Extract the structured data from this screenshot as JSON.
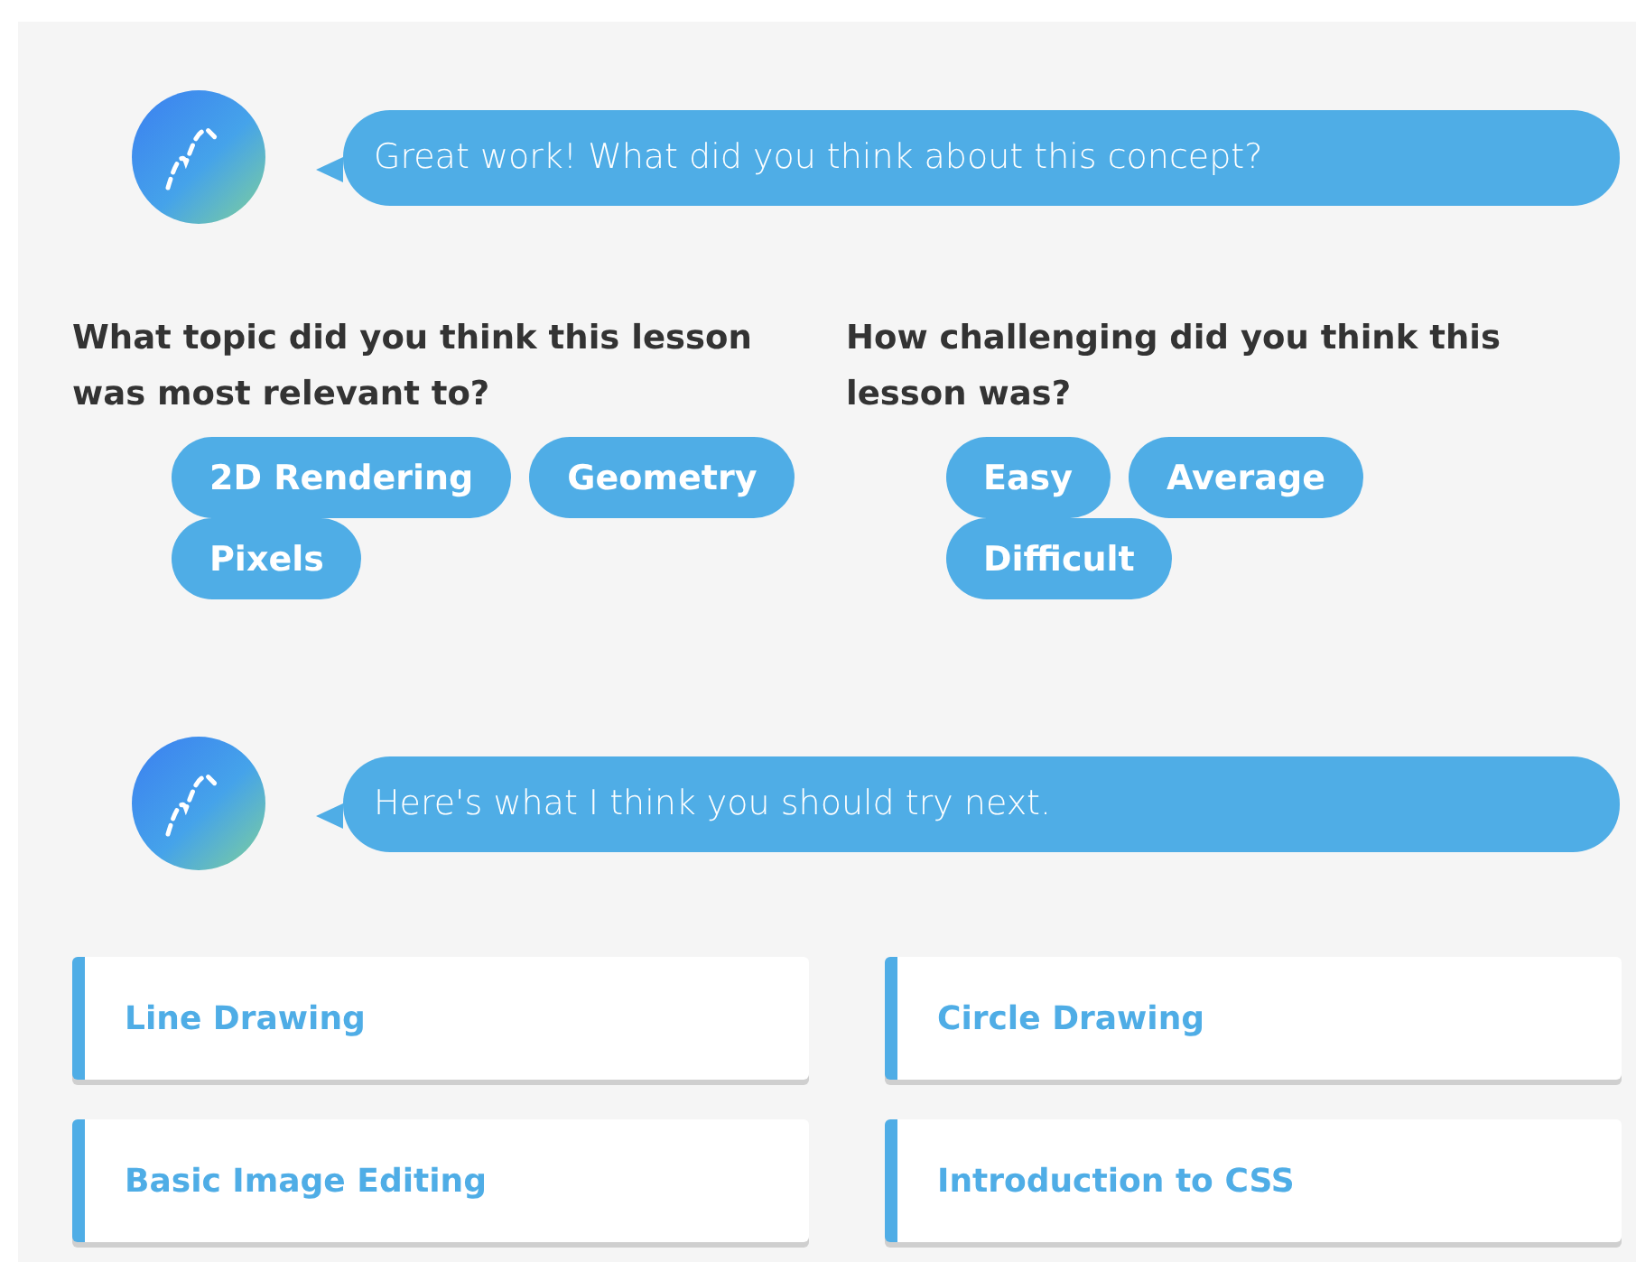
{
  "messages_top": {
    "text": "Great work! What did you think about this concept?"
  },
  "questions": [
    {
      "prompt": "What topic did you think this lesson was most relevant to?",
      "options": [
        "2D Rendering",
        "Geometry",
        "Pixels"
      ]
    },
    {
      "prompt": "How challenging did you think this lesson was?",
      "options": [
        "Easy",
        "Average",
        "Difficult"
      ]
    }
  ],
  "messages_bottom": {
    "text": "Here's what I think you should try next."
  },
  "suggestions": [
    "Line Drawing",
    "Circle Drawing",
    "Basic Image Editing",
    "Introduction to CSS"
  ]
}
